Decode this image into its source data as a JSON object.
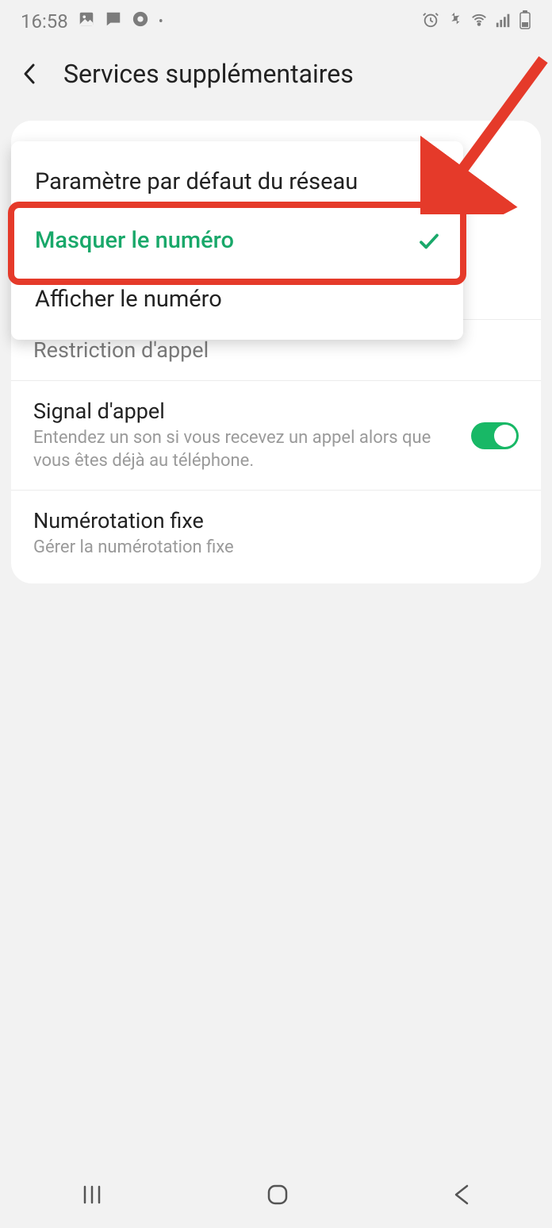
{
  "status": {
    "time": "16:58",
    "icons_left": [
      "image-icon",
      "chat-icon",
      "browser-icon",
      "dot-icon"
    ],
    "icons_right": [
      "alarm-icon",
      "vibrate-icon",
      "wifi-icon",
      "signal-icon",
      "battery-icon"
    ]
  },
  "header": {
    "title": "Services supplémentaires"
  },
  "popup": {
    "options": [
      {
        "label": "Paramètre par défaut du réseau",
        "selected": false
      },
      {
        "label": "Masquer le numéro",
        "selected": true
      },
      {
        "label": "Afficher le numéro",
        "selected": false
      }
    ]
  },
  "settings": {
    "restriction": {
      "title": "Restriction d'appel"
    },
    "call_waiting": {
      "title": "Signal d'appel",
      "subtitle": "Entendez un son si vous recevez un appel alors que vous êtes déjà au téléphone.",
      "enabled": true
    },
    "fixed_dialing": {
      "title": "Numérotation fixe",
      "subtitle": "Gérer la numérotation fixe"
    }
  },
  "colors": {
    "accent": "#19a86a",
    "annotation": "#e53a2a"
  }
}
